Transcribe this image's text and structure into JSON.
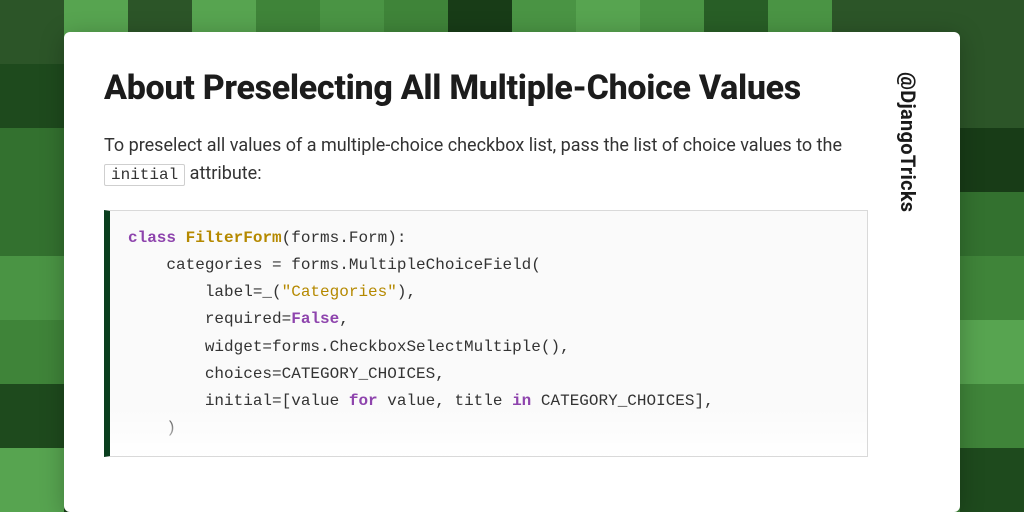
{
  "title": "About Preselecting All Multiple-Choice Values",
  "handle": "@DjangoTricks",
  "intro_before": "To preselect all values of a multiple-choice checkbox list, pass the list of choice values to the ",
  "intro_code": "initial",
  "intro_after": " attribute:",
  "code": {
    "line1_kw": "class",
    "line1_cls": "FilterForm",
    "line1_rest": "(forms.Form):",
    "line2": "    categories = forms.MultipleChoiceField(",
    "line3_a": "        label=_(",
    "line3_str": "\"Categories\"",
    "line3_b": "),",
    "line4_a": "        required=",
    "line4_bool": "False",
    "line4_b": ",",
    "line5": "        widget=forms.CheckboxSelectMultiple(),",
    "line6": "        choices=CATEGORY_CHOICES,",
    "line7_a": "        initial=[value ",
    "line7_for": "for",
    "line7_b": " value, title ",
    "line7_in": "in",
    "line7_c": " CATEGORY_CHOICES],",
    "line8": "    )"
  },
  "bg_palette": [
    "#183c17",
    "#1e4a1d",
    "#285e26",
    "#33712f",
    "#3f8439",
    "#4a9444",
    "#57a450",
    "#2c5528"
  ]
}
